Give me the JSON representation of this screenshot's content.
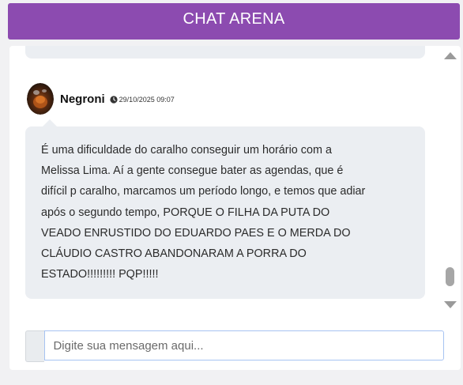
{
  "header": {
    "title": "CHAT ARENA",
    "background": "#8c4bb0"
  },
  "message": {
    "username": "Negroni",
    "timestamp": "29/10/2025 09:07",
    "text": "É uma dificuldade do caralho conseguir um horário com a\nMelissa Lima. Aí a gente consegue bater as agendas, que é\ndifícil p caralho, marcamos um período longo, e temos que adiar\napós o segundo tempo, PORQUE O FILHA DA PUTA DO\nVEADO ENRUSTIDO DO EDUARDO PAES E O MERDA DO\nCLÁUDIO CASTRO ABANDONARAM A PORRA DO\nESTADO!!!!!!!!! PQP!!!!!",
    "bubble_color": "#ebeef2"
  },
  "composer": {
    "placeholder": "Digite sua mensagem aqui...",
    "value": ""
  },
  "icons": {
    "clock": "clock-icon",
    "scroll_up": "arrow-up-icon",
    "scroll_down": "arrow-down-icon"
  }
}
